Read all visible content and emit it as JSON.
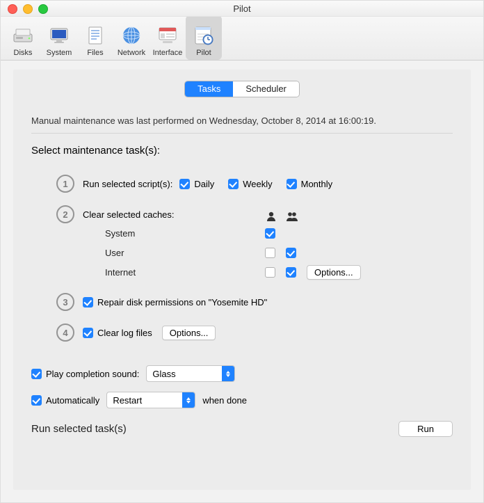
{
  "window": {
    "title": "Pilot"
  },
  "toolbar": {
    "items": [
      {
        "label": "Disks"
      },
      {
        "label": "System"
      },
      {
        "label": "Files"
      },
      {
        "label": "Network"
      },
      {
        "label": "Interface"
      },
      {
        "label": "Pilot"
      }
    ]
  },
  "tabs": {
    "tasks": "Tasks",
    "scheduler": "Scheduler"
  },
  "status": "Manual maintenance was last performed on Wednesday, October 8, 2014 at 16:00:19.",
  "heading": "Select maintenance task(s):",
  "scripts": {
    "label": "Run selected script(s):",
    "daily": "Daily",
    "weekly": "Weekly",
    "monthly": "Monthly"
  },
  "caches": {
    "label": "Clear selected caches:",
    "rows": {
      "system": "System",
      "user": "User",
      "internet": "Internet"
    },
    "options": "Options..."
  },
  "repair": "Repair disk permissions on \"Yosemite HD\"",
  "clearlogs": {
    "label": "Clear log files",
    "options": "Options..."
  },
  "sound": {
    "label": "Play completion sound:",
    "value": "Glass"
  },
  "auto": {
    "prefix": "Automatically",
    "value": "Restart",
    "suffix": "when done"
  },
  "footer": {
    "label": "Run selected task(s)",
    "run": "Run"
  }
}
